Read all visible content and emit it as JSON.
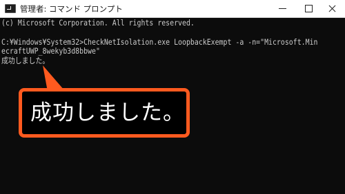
{
  "titlebar": {
    "title": "管理者: コマンド プロンプト",
    "app_icon": "terminal-icon",
    "minimize_icon": "minimize-icon",
    "maximize_icon": "maximize-icon",
    "close_icon": "close-icon"
  },
  "console": {
    "copyright": "(c) Microsoft Corporation. All rights reserved.",
    "command_line_1": "C:¥Windows¥System32>CheckNetIsolation.exe LoopbackExempt -a -n=\"Microsoft.Min",
    "command_line_2": "ecraftUWP_8wekyb3d8bbwe\"",
    "result": "成功しました。"
  },
  "callout": {
    "text": "成功しました。",
    "border_color": "#ff5a1f"
  },
  "colors": {
    "console_bg": "#0c0c0c",
    "console_text": "#cccccc",
    "accent": "#ff5a1f"
  }
}
